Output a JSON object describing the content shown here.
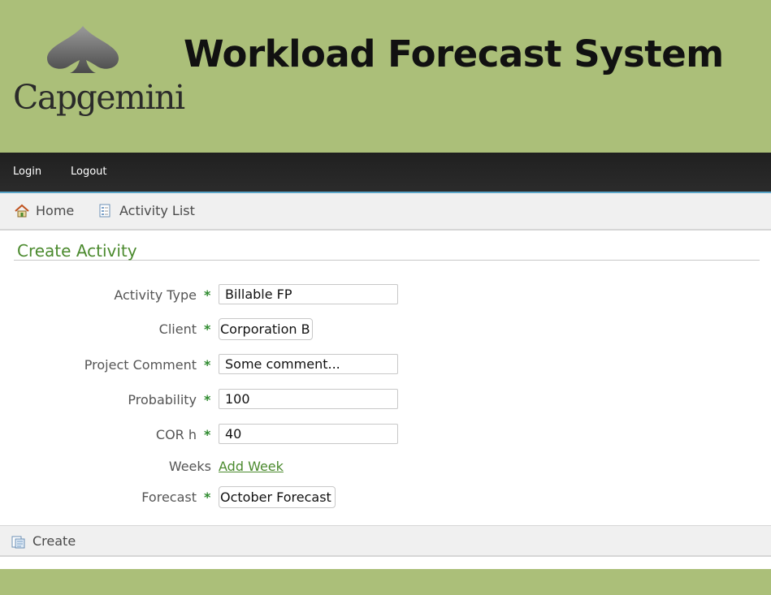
{
  "header": {
    "logo_text": "Capgemini",
    "app_title": "Workload Forecast System"
  },
  "nav": {
    "login": "Login",
    "logout": "Logout"
  },
  "menu": {
    "home": "Home",
    "activity_list": "Activity List"
  },
  "form": {
    "title": "Create Activity",
    "fields": [
      {
        "label": "Activity Type",
        "required": "*",
        "value": "Billable FP"
      },
      {
        "label": "Client",
        "required": "*",
        "value": "Corporation B"
      },
      {
        "label": "Project Comment",
        "required": "*",
        "value": "Some comment..."
      },
      {
        "label": "Probability",
        "required": "*",
        "value": "100"
      },
      {
        "label": "COR h",
        "required": "*",
        "value": "40"
      },
      {
        "label": "Weeks",
        "link": "Add Week"
      },
      {
        "label": "Forecast",
        "required": "*",
        "value": "October Forecast"
      }
    ]
  },
  "actions": {
    "create": "Create"
  },
  "colors": {
    "banner": "#abbf79",
    "accent": "#4b8a2e",
    "navbar": "#242424"
  },
  "icons": [
    "spade-logo-icon",
    "home-icon",
    "document-list-icon",
    "create-document-icon"
  ]
}
